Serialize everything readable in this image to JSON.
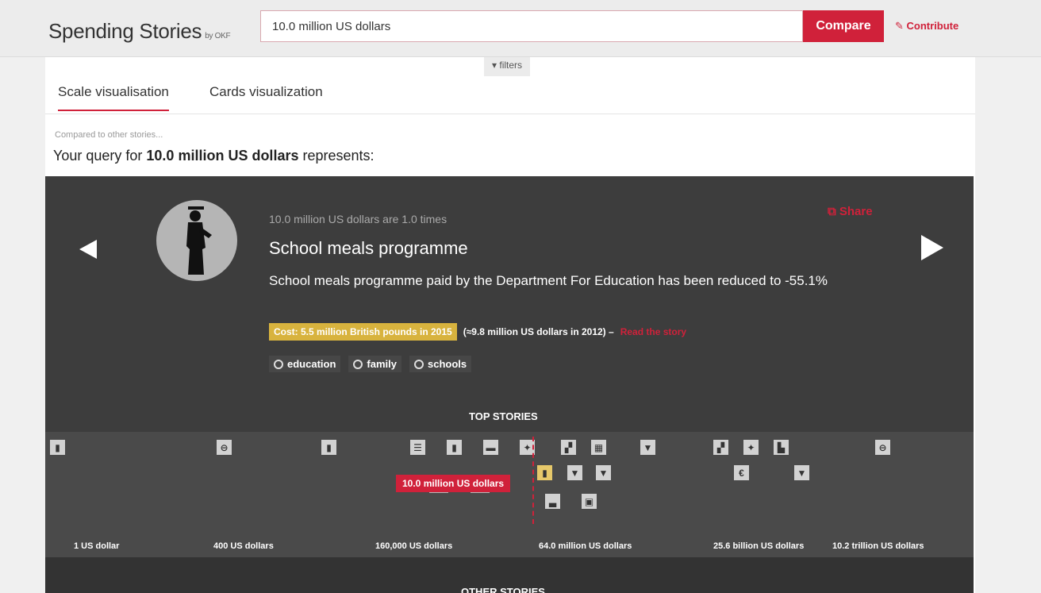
{
  "header": {
    "brand": "Spending Stories",
    "brand_suffix": "by OKF",
    "search_value": "10.0 million US dollars",
    "compare_label": "Compare",
    "contribute_label": "Contribute"
  },
  "filters_label": "▾ filters",
  "tabs": [
    {
      "label": "Scale visualisation",
      "active": true
    },
    {
      "label": "Cards visualization",
      "active": false
    }
  ],
  "summary": {
    "compared": "Compared to other stories...",
    "prefix": "Your query for ",
    "amount": "10.0 million US dollars",
    "suffix": " represents:"
  },
  "story": {
    "times": "10.0 million US dollars are 1.0 times",
    "title": "School meals programme",
    "description": "School meals programme paid by the Department For Education has been reduced to -55.1%",
    "cost": "Cost: 5.5 million British pounds in 2015",
    "cost_usd": "(≈9.8 million US dollars in 2012)  –",
    "read_story": "Read the story",
    "share": "Share",
    "tags": [
      {
        "label": "education"
      },
      {
        "label": "family"
      },
      {
        "label": "schools"
      }
    ]
  },
  "scale": {
    "heading": "TOP STORIES",
    "current_label": "10.0 million US dollars",
    "axis_labels": [
      "1 US dollar",
      "400 US dollars",
      "160,000 US dollars",
      "64.0 million US dollars",
      "25.6 billion US dollars",
      "10.2 trillion US dollars"
    ]
  },
  "other_stories": "OTHER STORIES",
  "colors": {
    "accent": "#d0213a",
    "cost_badge": "#d8b33e",
    "panel_dark": "#3d3d3d",
    "scale_band": "#4a4a4a"
  }
}
